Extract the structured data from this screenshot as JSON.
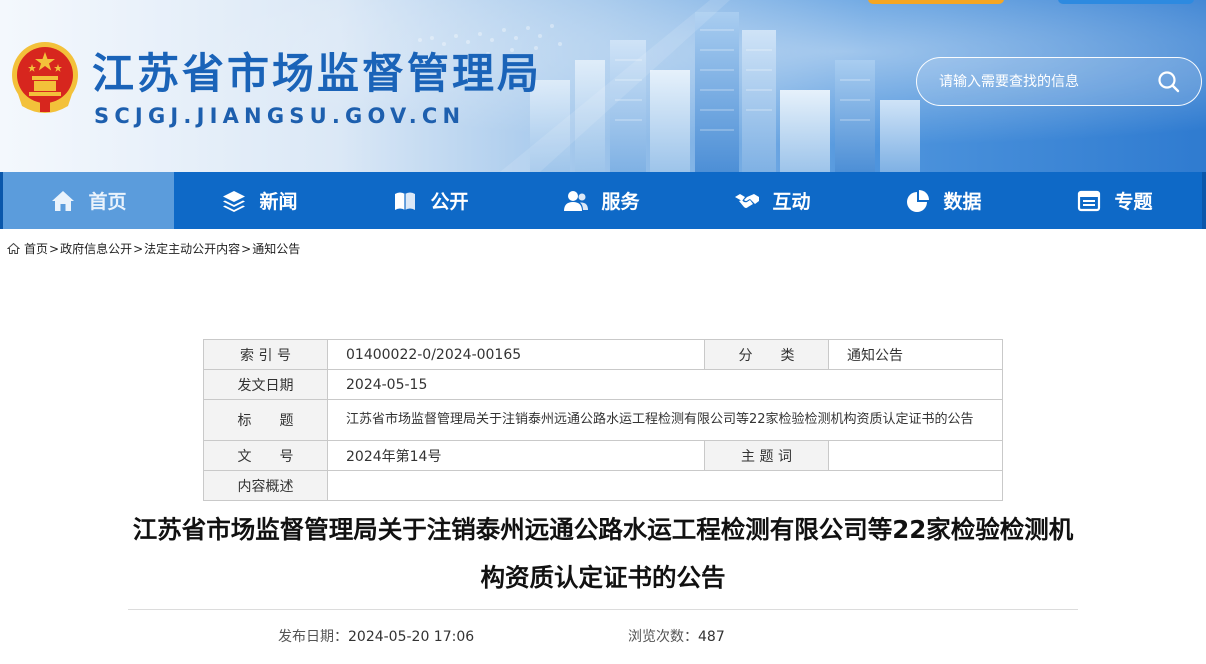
{
  "header": {
    "site_title": "江苏省市场监督管理局",
    "site_domain": "SCJGJ.JIANGSU.GOV.CN",
    "search_placeholder": "请输入需要查找的信息"
  },
  "nav": {
    "items": [
      {
        "label": "首页",
        "icon": "home-icon",
        "active": true
      },
      {
        "label": "新闻",
        "icon": "layers-icon"
      },
      {
        "label": "公开",
        "icon": "open-book-icon"
      },
      {
        "label": "服务",
        "icon": "user-group-icon"
      },
      {
        "label": "互动",
        "icon": "handshake-icon"
      },
      {
        "label": "数据",
        "icon": "pie-chart-icon"
      },
      {
        "label": "专题",
        "icon": "topic-window-icon"
      }
    ]
  },
  "breadcrumb": {
    "items": [
      "首页",
      "政府信息公开",
      "法定主动公开内容",
      "通知公告"
    ],
    "separator": ">"
  },
  "meta": {
    "index_label": "索 引 号",
    "index_value": "01400022-0/2024-00165",
    "category_label": "分　　类",
    "category_value": "通知公告",
    "date_label": "发文日期",
    "date_value": "2024-05-15",
    "title_label": "标　　题",
    "title_value": "江苏省市场监督管理局关于注销泰州远通公路水运工程检测有限公司等22家检验检测机构资质认定证书的公告",
    "docno_label": "文　　号",
    "docno_value": "2024年第14号",
    "keywords_label": "主 题 词",
    "keywords_value": "",
    "summary_label": "内容概述",
    "summary_value": ""
  },
  "article": {
    "title": "江苏省市场监督管理局关于注销泰州远通公路水运工程检测有限公司等22家检验检测机构资质认定证书的公告",
    "publish_label": "发布日期：",
    "publish_value": "2024-05-20 17:06",
    "views_label": "浏览次数：",
    "views_value": "487"
  },
  "colors": {
    "nav_bg": "#0e69c7",
    "nav_active": "#5b9cdc",
    "title_blue": "#1a63b8",
    "emblem_red": "#d7261e",
    "emblem_gold": "#f3c13a"
  }
}
